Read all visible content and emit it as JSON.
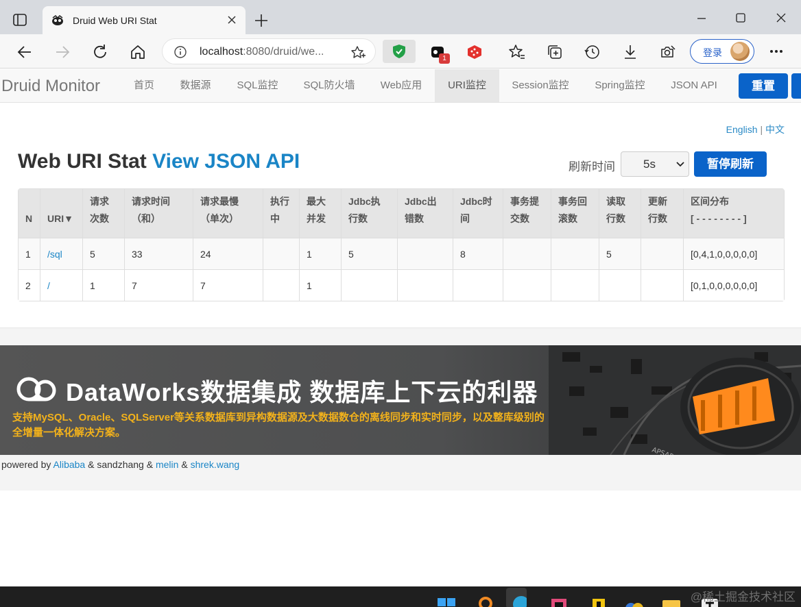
{
  "browser": {
    "tab_title": "Druid Web URI Stat",
    "url_host": "localhost",
    "url_rest": ":8080/druid/we...",
    "extension_badge": "1",
    "login_label": "登录"
  },
  "nav": {
    "brand": "Druid Monitor",
    "items": [
      "首页",
      "数据源",
      "SQL监控",
      "SQL防火墙",
      "Web应用",
      "URI监控",
      "Session监控",
      "Spring监控",
      "JSON API"
    ],
    "active": "URI监控",
    "reset_label": "重置"
  },
  "lang": {
    "english": "English",
    "separator": "|",
    "chinese": "中文"
  },
  "header": {
    "title": "Web URI Stat",
    "json_link": "View JSON API",
    "refresh_label": "刷新时间",
    "refresh_value": "5s",
    "pause_label": "暂停刷新"
  },
  "table": {
    "headers": [
      [
        "N"
      ],
      [
        "URI▼"
      ],
      [
        "请求",
        "次数"
      ],
      [
        "请求时间",
        "（和）"
      ],
      [
        "请求最慢",
        "（单次）"
      ],
      [
        "执行",
        "中"
      ],
      [
        "最大",
        "并发"
      ],
      [
        "Jdbc执",
        "行数"
      ],
      [
        "Jdbc出",
        "错数"
      ],
      [
        "Jdbc时",
        "间"
      ],
      [
        "事务提",
        "交数"
      ],
      [
        "事务回",
        "滚数"
      ],
      [
        "读取",
        "行数"
      ],
      [
        "更新",
        "行数"
      ],
      [
        "区间分布",
        "[ - - - - - - - - ]"
      ]
    ],
    "rows": [
      [
        "1",
        "/sql",
        "5",
        "33",
        "24",
        "",
        "1",
        "5",
        "",
        "8",
        "",
        "",
        "5",
        "",
        "[0,4,1,0,0,0,0,0]"
      ],
      [
        "2",
        "/",
        "1",
        "7",
        "7",
        "",
        "1",
        "",
        "",
        "",
        "",
        "",
        "",
        "",
        "[0,1,0,0,0,0,0,0]"
      ]
    ]
  },
  "banner": {
    "headline": "DataWorks数据集成 数据库上下云的利器",
    "subtitle": "支持MySQL、Oracle、SQLServer等关系数据库到异构数据源及大数据数仓的离线同步和实时同步，以及整库级别的全增量一体化解决方案。",
    "art_text": "APSARA"
  },
  "footer": {
    "prefix": "powered by",
    "alibaba": "Alibaba",
    "amp1": "&",
    "sandzhang": "sandzhang",
    "amp2": "&",
    "melin": "melin",
    "amp3": "&",
    "shrek": "shrek.wang"
  },
  "watermark": "@稀土掘金技术社区",
  "colors": {
    "primary_button": "#0a63c9",
    "link": "#1a85c6",
    "banner_accent": "#f3b21b"
  }
}
